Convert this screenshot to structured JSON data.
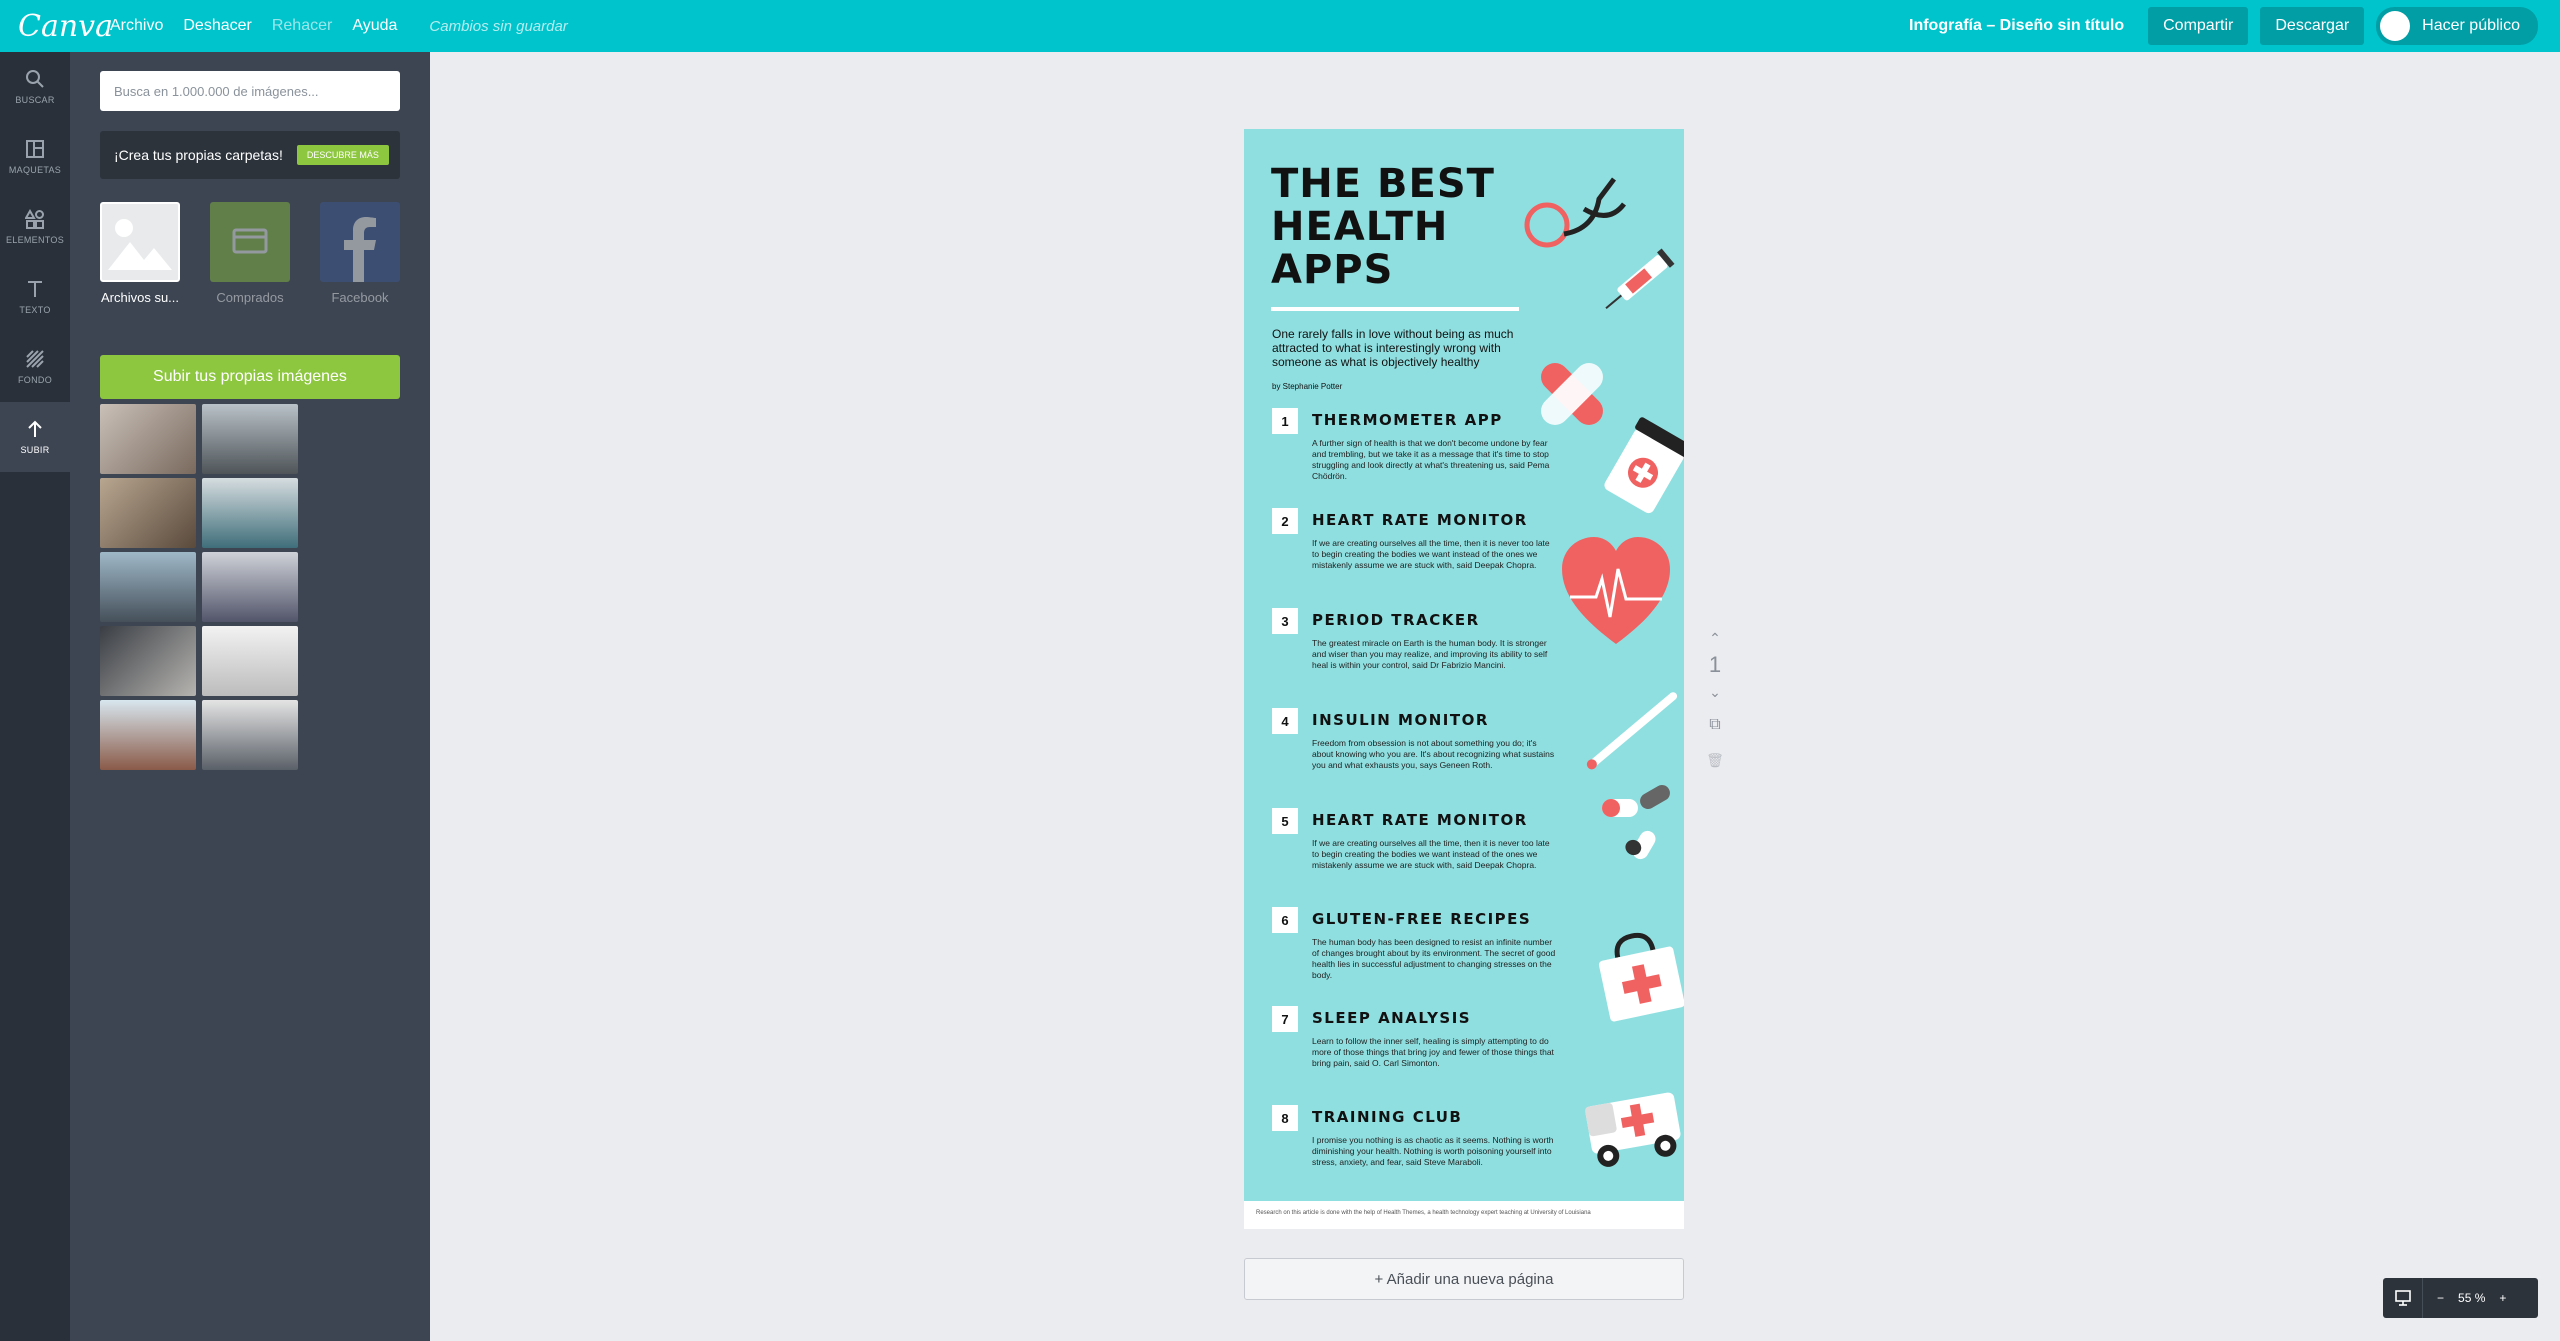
{
  "topbar": {
    "logo": "Canva",
    "menu": [
      "Archivo",
      "Deshacer",
      "Rehacer",
      "Ayuda"
    ],
    "status": "Cambios sin guardar",
    "doc_title": "Infografía – Diseño sin título",
    "share": "Compartir",
    "download": "Descargar",
    "make_public": "Hacer público"
  },
  "rail": [
    {
      "label": "BUSCAR",
      "icon": "search-icon"
    },
    {
      "label": "MAQUETAS",
      "icon": "layouts-icon"
    },
    {
      "label": "ELEMENTOS",
      "icon": "elements-icon"
    },
    {
      "label": "TEXTO",
      "icon": "text-icon"
    },
    {
      "label": "FONDO",
      "icon": "background-icon"
    },
    {
      "label": "SUBIR",
      "icon": "upload-icon"
    }
  ],
  "panel": {
    "search_placeholder": "Busca en 1.000.000 de imágenes...",
    "folders_text": "¡Crea tus propias carpetas!",
    "discover": "DESCUBRE MÁS",
    "sources": [
      "Archivos su...",
      "Comprados",
      "Facebook"
    ],
    "upload_button": "Subir tus propias imágenes"
  },
  "infographic": {
    "title": "THE BEST HEALTH APPS",
    "intro": "One rarely falls in love without being as much attracted to what is interestingly wrong with someone as what is objectively healthy",
    "byline": "by Stephanie Potter",
    "items": [
      {
        "num": "1",
        "title": "THERMOMETER APP",
        "body": "A further sign of health is that we don't become undone by fear and trembling, but we take it as a message that it's time to stop struggling and look directly at what's threatening us, said Pema Chödrön."
      },
      {
        "num": "2",
        "title": "HEART RATE MONITOR",
        "body": "If we are creating ourselves all the time, then it is never too late to begin creating the bodies we want instead of the ones we mistakenly assume we are stuck with, said Deepak Chopra."
      },
      {
        "num": "3",
        "title": "PERIOD TRACKER",
        "body": "The greatest miracle on Earth is the human body. It is stronger and wiser than you may realize, and improving its ability to self heal is within your control, said Dr Fabrizio Mancini."
      },
      {
        "num": "4",
        "title": "INSULIN MONITOR",
        "body": "Freedom from obsession is not about something you do; it's about knowing who you are. It's about recognizing what sustains you and what exhausts you, says Geneen Roth."
      },
      {
        "num": "5",
        "title": "HEART RATE MONITOR",
        "body": "If we are creating ourselves all the time, then it is never too late to begin creating the bodies we want instead of the ones we mistakenly assume we are stuck with, said Deepak Chopra."
      },
      {
        "num": "6",
        "title": "GLUTEN-FREE RECIPES",
        "body": "The human body has been designed to resist an infinite number of changes brought about by its environment. The secret of good health lies in successful adjustment to changing stresses on the body."
      },
      {
        "num": "7",
        "title": "SLEEP ANALYSIS",
        "body": "Learn to follow the inner self, healing is simply attempting to do more of those things that bring joy and fewer of those things that bring pain, said O. Carl Simonton."
      },
      {
        "num": "8",
        "title": "TRAINING CLUB",
        "body": "I promise you nothing is as chaotic as it seems. Nothing is worth diminishing your health. Nothing is worth poisoning yourself into stress, anxiety, and fear, said Steve Maraboli."
      }
    ],
    "footer": "Research on this article is done with the help of Health Themes, a health technology expert teaching at University of Louisiana"
  },
  "canvas": {
    "page_number": "1",
    "add_page": "+ Añadir una nueva página",
    "zoom": "55 %"
  },
  "colors": {
    "brand": "#00c4cc",
    "infographic_bg": "#8fdfe0",
    "upload_green": "#8dc63f",
    "red_accent": "#f06262"
  }
}
